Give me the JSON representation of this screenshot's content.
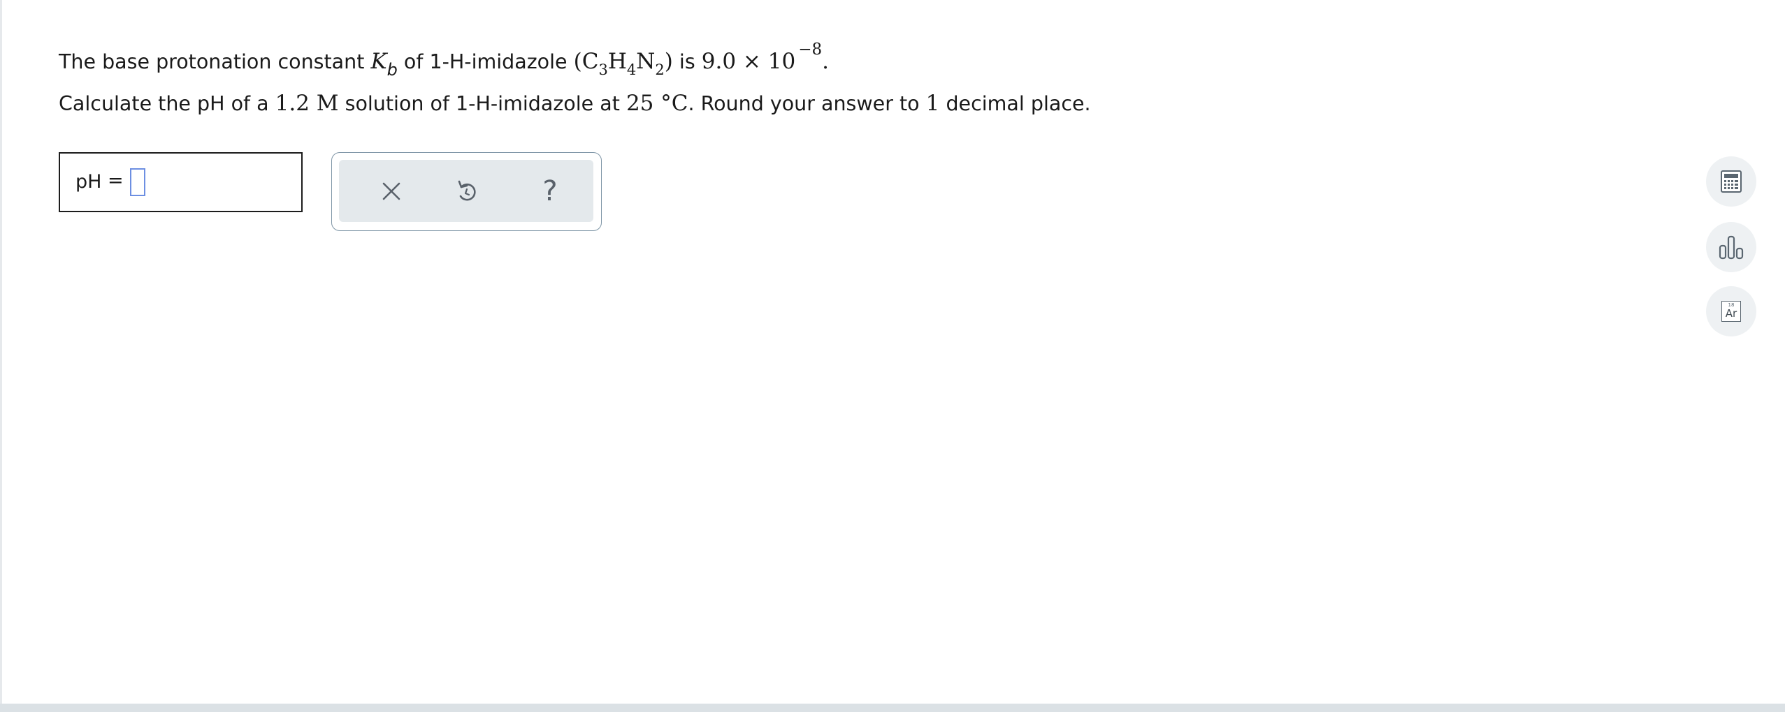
{
  "question": {
    "line1": {
      "intro": "The base protonation constant ",
      "k_symbol": "K",
      "k_subscript": "b",
      "of_text": " of ",
      "compound_name": "1-H-imidazole",
      "formula_open": "(C",
      "c_count": "3",
      "h_symbol": "H",
      "h_count": "4",
      "n_symbol": "N",
      "n_count": "2",
      "formula_close": ")",
      "is_text": " is ",
      "value_mantissa": "9.0 × 10",
      "value_exponent": "−8",
      "period": "."
    },
    "line2": {
      "text_a": "Calculate the pH of a ",
      "concentration": "1.2 M",
      "text_b": " solution of 1-H-imidazole at ",
      "temperature": "25 °C",
      "text_c": ". Round your answer to ",
      "decimals": "1",
      "text_d": " decimal place."
    }
  },
  "answer": {
    "label": "pH",
    "equals": "=",
    "value": ""
  },
  "toolbar": {
    "clear_icon": "close-icon",
    "undo_icon": "undo-icon",
    "help_label": "?"
  },
  "side_tools": {
    "calculator_icon": "calculator-icon",
    "data_icon": "bar-chart-icon",
    "periodic_table": {
      "number": "18",
      "symbol": "Ar"
    }
  },
  "colors": {
    "input_border": "#6d8fe2",
    "toolbar_bg": "#e4e9ec",
    "side_button_bg": "#eef1f3"
  }
}
